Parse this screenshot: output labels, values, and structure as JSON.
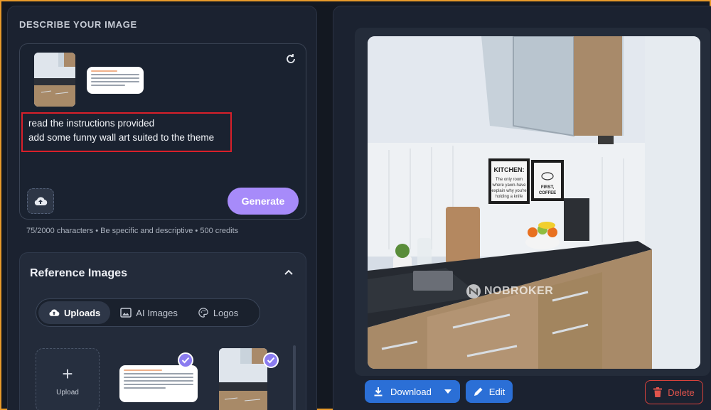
{
  "prompt_section": {
    "title": "DESCRIBE YOUR IMAGE",
    "prompt_text": "read the instructions provided\nadd some funny wall art suited to the theme",
    "generate_label": "Generate",
    "char_info": "75/2000 characters • Be specific and descriptive • 500 credits"
  },
  "reference_images": {
    "title": "Reference Images",
    "tabs": [
      {
        "label": "Uploads",
        "icon": "cloud-upload-icon",
        "active": true
      },
      {
        "label": "AI Images",
        "icon": "image-icon",
        "active": false
      },
      {
        "label": "Logos",
        "icon": "palette-icon",
        "active": false
      }
    ],
    "upload_label": "Upload"
  },
  "result": {
    "watermark": "NOBROKER",
    "download_label": "Download",
    "edit_label": "Edit",
    "delete_label": "Delete"
  },
  "colors": {
    "accent_purple": "#a78bfa",
    "primary_blue": "#2b6fd6",
    "danger_red": "#d9423c",
    "highlight_border": "#d9202a"
  }
}
